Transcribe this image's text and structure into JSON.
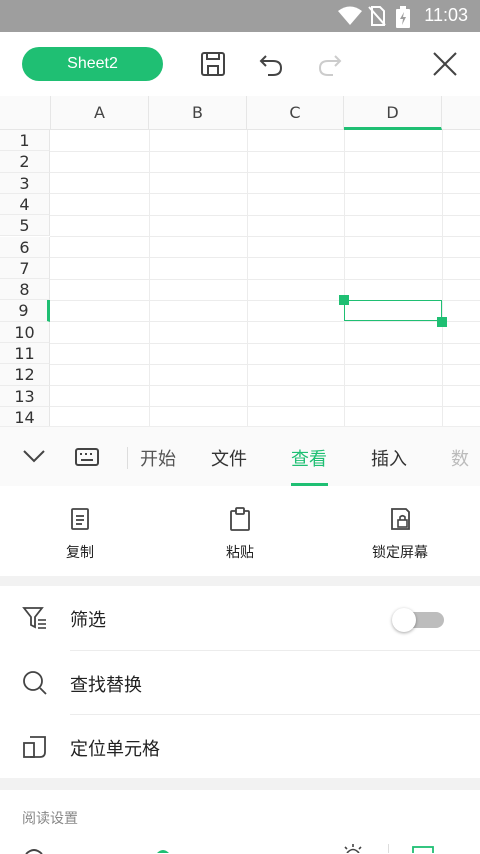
{
  "status_bar": {
    "time": "11:03"
  },
  "toolbar": {
    "sheet_name": "Sheet2"
  },
  "spreadsheet": {
    "columns": [
      "A",
      "B",
      "C",
      "D"
    ],
    "rows": [
      "1",
      "2",
      "3",
      "4",
      "5",
      "6",
      "7",
      "8",
      "9",
      "10",
      "11",
      "12",
      "13",
      "14"
    ],
    "selected_cell": "D9"
  },
  "ribbon_tabs": {
    "partial_left": "开始",
    "files": "文件",
    "view": "查看",
    "insert": "插入",
    "partial_right": "数"
  },
  "actions": {
    "copy": "复制",
    "paste": "粘贴",
    "lock_screen": "锁定屏幕"
  },
  "menu": {
    "filter": "筛选",
    "find_replace": "查找替换",
    "locate_cell": "定位单元格",
    "filter_toggle_on": false
  },
  "reading_settings": {
    "title": "阅读设置"
  },
  "colors": {
    "accent": "#1fbf73",
    "status_bar": "#9e9e9e"
  }
}
